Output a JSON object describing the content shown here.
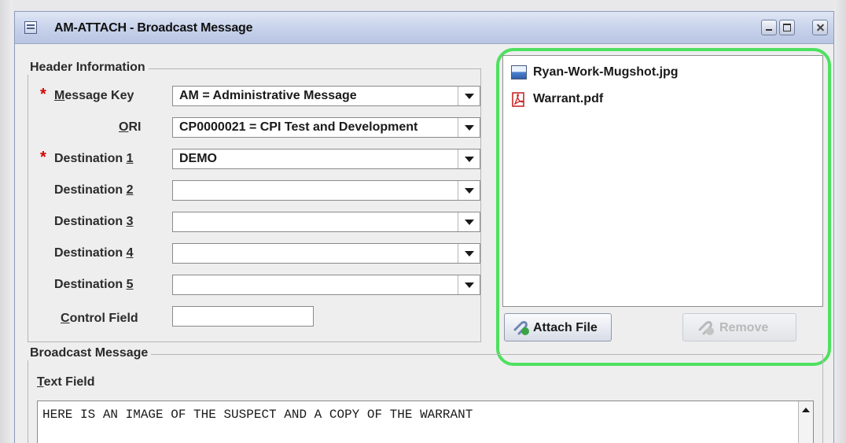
{
  "window": {
    "title": "AM-ATTACH - Broadcast Message"
  },
  "header_group": {
    "title": "Header Information",
    "message_key": {
      "label": "Message Key",
      "mnemonic_prefix": "",
      "mnemonic": "M",
      "mnemonic_suffix": "essage Key",
      "value": "AM = Administrative Message",
      "required": true
    },
    "ori": {
      "label_prefix": "",
      "mnemonic": "O",
      "label_suffix": "RI",
      "value": "CP0000021 = CPI Test and Development"
    },
    "destinations": [
      {
        "label_prefix": "Destination ",
        "mnemonic": "1",
        "value": "DEMO",
        "required": true
      },
      {
        "label_prefix": "Destination ",
        "mnemonic": "2",
        "value": ""
      },
      {
        "label_prefix": "Destination ",
        "mnemonic": "3",
        "value": ""
      },
      {
        "label_prefix": "Destination ",
        "mnemonic": "4",
        "value": ""
      },
      {
        "label_prefix": "Destination ",
        "mnemonic": "5",
        "value": ""
      }
    ],
    "control_field": {
      "mnemonic": "C",
      "label_suffix": "ontrol Field",
      "value": ""
    }
  },
  "attachments": {
    "files": [
      {
        "name": "Ryan-Work-Mugshot.jpg",
        "icon": "image-file-icon"
      },
      {
        "name": "Warrant.pdf",
        "icon": "pdf-file-icon"
      }
    ],
    "attach_button": "Attach File",
    "remove_button": "Remove",
    "highlight_color": "#4ee060"
  },
  "broadcast_group": {
    "title": "Broadcast Message",
    "text_field_mnemonic": "T",
    "text_field_label_suffix": "ext Field",
    "text_value": "HERE IS AN IMAGE OF THE SUSPECT AND A COPY OF THE WARRANT"
  },
  "colors": {
    "required_star": "#d40000",
    "titlebar": "#c6d1ea"
  }
}
